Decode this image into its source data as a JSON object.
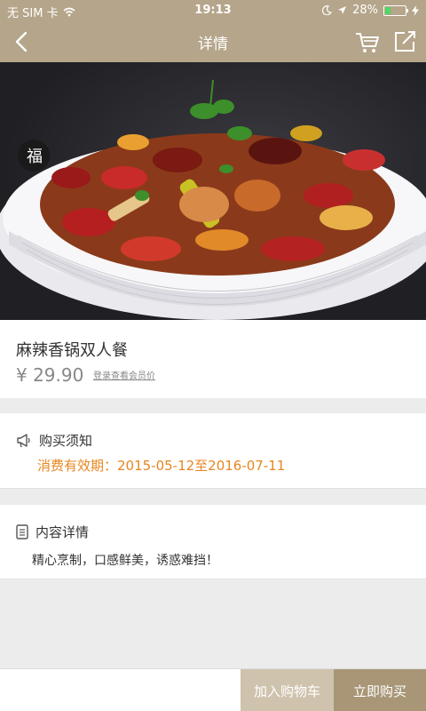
{
  "status_bar": {
    "carrier": "无 SIM 卡",
    "time": "19:13",
    "battery": "28%",
    "battery_level": 0.28,
    "icons": [
      "wifi-icon",
      "moon-icon",
      "location-arrow-icon",
      "battery-icon",
      "charging-icon"
    ]
  },
  "nav": {
    "title": "详情",
    "icons": [
      "back-arrow-icon",
      "cart-icon",
      "share-icon"
    ]
  },
  "product": {
    "name": "麻辣香锅双人餐",
    "price": "¥ 29.90",
    "member_link": "登录查看会员价"
  },
  "notice": {
    "title": "购买须知",
    "validity": "消费有效期：2015-05-12至2016-07-11",
    "icon": "megaphone-icon"
  },
  "detail": {
    "title": "内容详情",
    "text": "精心烹制，口感鲜美，诱惑难挡！",
    "icon": "document-icon"
  },
  "actions": {
    "add_to_cart": "加入购物车",
    "buy_now": "立即购买"
  },
  "colors": {
    "header": "#b5a58a",
    "accent_orange": "#e8861f",
    "add_to_cart_bg": "#cfc3ae",
    "buy_now_bg": "#a89677"
  }
}
